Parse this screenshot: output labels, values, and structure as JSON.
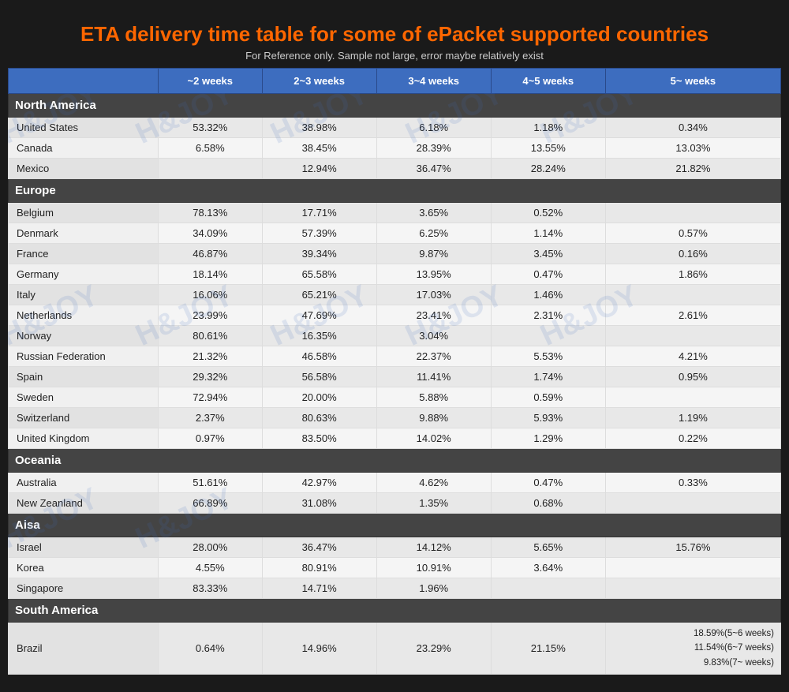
{
  "title": {
    "main_before": "ETA delivery time table for some of ",
    "highlight": "ePacket",
    "main_after": " supported countries",
    "subtitle": "For Reference only. Sample not large, error maybe relatively exist"
  },
  "columns": [
    "~2 weeks",
    "2~3 weeks",
    "3~4 weeks",
    "4~5 weeks",
    "5~  weeks"
  ],
  "sections": [
    {
      "name": "North America",
      "rows": [
        {
          "country": "United States",
          "c1": "53.32%",
          "c2": "38.98%",
          "c3": "6.18%",
          "c4": "1.18%",
          "c5": "0.34%"
        },
        {
          "country": "Canada",
          "c1": "6.58%",
          "c2": "38.45%",
          "c3": "28.39%",
          "c4": "13.55%",
          "c5": "13.03%"
        },
        {
          "country": "Mexico",
          "c1": "",
          "c2": "12.94%",
          "c3": "36.47%",
          "c4": "28.24%",
          "c5": "21.82%"
        }
      ]
    },
    {
      "name": "Europe",
      "rows": [
        {
          "country": "Belgium",
          "c1": "78.13%",
          "c2": "17.71%",
          "c3": "3.65%",
          "c4": "0.52%",
          "c5": ""
        },
        {
          "country": "Denmark",
          "c1": "34.09%",
          "c2": "57.39%",
          "c3": "6.25%",
          "c4": "1.14%",
          "c5": "0.57%"
        },
        {
          "country": "France",
          "c1": "46.87%",
          "c2": "39.34%",
          "c3": "9.87%",
          "c4": "3.45%",
          "c5": "0.16%"
        },
        {
          "country": "Germany",
          "c1": "18.14%",
          "c2": "65.58%",
          "c3": "13.95%",
          "c4": "0.47%",
          "c5": "1.86%"
        },
        {
          "country": "Italy",
          "c1": "16.06%",
          "c2": "65.21%",
          "c3": "17.03%",
          "c4": "1.46%",
          "c5": ""
        },
        {
          "country": "Netherlands",
          "c1": "23.99%",
          "c2": "47.69%",
          "c3": "23.41%",
          "c4": "2.31%",
          "c5": "2.61%"
        },
        {
          "country": "Norway",
          "c1": "80.61%",
          "c2": "16.35%",
          "c3": "3.04%",
          "c4": "",
          "c5": ""
        },
        {
          "country": "Russian Federation",
          "c1": "21.32%",
          "c2": "46.58%",
          "c3": "22.37%",
          "c4": "5.53%",
          "c5": "4.21%"
        },
        {
          "country": "Spain",
          "c1": "29.32%",
          "c2": "56.58%",
          "c3": "11.41%",
          "c4": "1.74%",
          "c5": "0.95%"
        },
        {
          "country": "Sweden",
          "c1": "72.94%",
          "c2": "20.00%",
          "c3": "5.88%",
          "c4": "0.59%",
          "c5": ""
        },
        {
          "country": "Switzerland",
          "c1": "2.37%",
          "c2": "80.63%",
          "c3": "9.88%",
          "c4": "5.93%",
          "c5": "1.19%"
        },
        {
          "country": "United Kingdom",
          "c1": "0.97%",
          "c2": "83.50%",
          "c3": "14.02%",
          "c4": "1.29%",
          "c5": "0.22%"
        }
      ]
    },
    {
      "name": "Oceania",
      "rows": [
        {
          "country": "Australia",
          "c1": "51.61%",
          "c2": "42.97%",
          "c3": "4.62%",
          "c4": "0.47%",
          "c5": "0.33%"
        },
        {
          "country": "New Zeanland",
          "c1": "66.89%",
          "c2": "31.08%",
          "c3": "1.35%",
          "c4": "0.68%",
          "c5": ""
        }
      ]
    },
    {
      "name": "Aisa",
      "rows": [
        {
          "country": "Israel",
          "c1": "28.00%",
          "c2": "36.47%",
          "c3": "14.12%",
          "c4": "5.65%",
          "c5": "15.76%"
        },
        {
          "country": "Korea",
          "c1": "4.55%",
          "c2": "80.91%",
          "c3": "10.91%",
          "c4": "3.64%",
          "c5": ""
        },
        {
          "country": "Singapore",
          "c1": "83.33%",
          "c2": "14.71%",
          "c3": "1.96%",
          "c4": "",
          "c5": ""
        }
      ]
    },
    {
      "name": "South America",
      "rows": [
        {
          "country": "Brazil",
          "c1": "0.64%",
          "c2": "14.96%",
          "c3": "23.29%",
          "c4": "21.15%",
          "c5": "18.59%(5~6 weeks)\n11.54%(6~7 weeks)\n9.83%(7~ weeks)"
        }
      ]
    }
  ],
  "watermark": "H&JOY"
}
